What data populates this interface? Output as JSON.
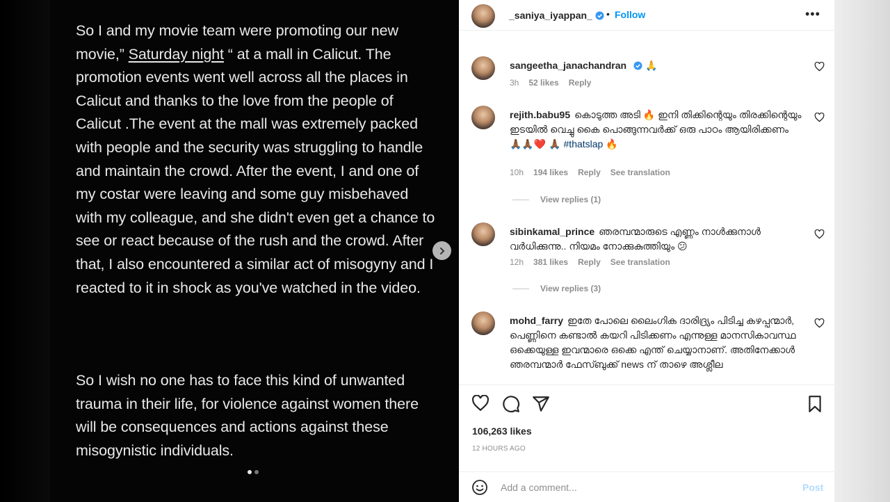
{
  "media": {
    "paragraph1": {
      "before": "So I and my movie team were promoting our new movie,”",
      "underlined": "Saturday night",
      "after": "“ at a mall in Calicut. The promotion events  went well across all the places in Calicut and thanks to the love from the people of Calicut .The event at the mall was extremely packed with people and the security was struggling to handle and maintain the crowd. After the event, I and one of my costar were leaving and some guy misbehaved with my colleague, and she didn't even get a chance to see or react because of the rush and the crowd. After that, I also encountered a similar act of misogyny and I reacted to it in shock as you've watched in the video."
    },
    "paragraph2": "So I wish no one has to face this kind of unwanted trauma in their life, for violence against women there will be consequences and actions against these misogynistic individuals.",
    "carousel": {
      "total": 2,
      "current": 1
    }
  },
  "header": {
    "username": "_saniya_iyappan_",
    "separator": "•",
    "follow_label": "Follow",
    "more_icon": "more-horizontal-icon"
  },
  "comments": [
    {
      "username": "sangeetha_janachandran",
      "text": "",
      "verified": true,
      "emoji": "🙏",
      "time": "3h",
      "likes": "52 likes",
      "reply": "Reply"
    },
    {
      "username": "rejith.babu95",
      "text": "കൊടുത്ത അടി 🔥 ഇനി തിക്കിന്റെയും തിരക്കിന്റെയും ഇടയിൽ വെച്ചു കൈ പൊങ്ങുന്നവർക്ക് ഒരു പാഠം ആയിരിക്കണം 🙏🏾🙏🏾❤️ 🙏🏾",
      "hashtag": "#thatslap",
      "hashtag_emoji": "🔥",
      "time": "10h",
      "likes": "194 likes",
      "reply": "Reply",
      "translate": "See translation",
      "view_replies": "View replies (1)"
    },
    {
      "username": "sibinkamal_prince",
      "text": "ഞരമ്പന്മാരുടെ എണ്ണം നാൾക്കുനാൾ വർധിക്കുന്നു.. നിയമം നോക്കുകുത്തിയും 😕",
      "time": "12h",
      "likes": "381 likes",
      "reply": "Reply",
      "translate": "See translation",
      "view_replies": "View replies (3)"
    },
    {
      "username": "mohd_farry",
      "text": "ഇതേ പോലെ ലൈംഗിക ദാരിദ്ര്യം പിടിച്ച കഴപ്പന്മാർ, പെണ്ണിനെ കണ്ടാൽ കയറി പിടിക്കണം എന്നുള്ള മാനസികാവസ്ഥ ഒക്കെയുള്ള ഇവന്മാരെ ഒക്കെ എന്ത് ചെയ്യാനാണ്. അതിനേക്കാൾ ഞരമ്പന്മാർ ഫേസ്ബുക്ക് news ന് താഴെ അശ്ലീല"
    }
  ],
  "actions": {
    "like_icon": "heart-icon",
    "comment_icon": "comment-icon",
    "share_icon": "send-icon",
    "save_icon": "bookmark-icon"
  },
  "stats": {
    "likes": "106,263 likes",
    "time_ago": "12 HOURS AGO"
  },
  "comment_box": {
    "placeholder": "Add a comment...",
    "post_label": "Post"
  }
}
